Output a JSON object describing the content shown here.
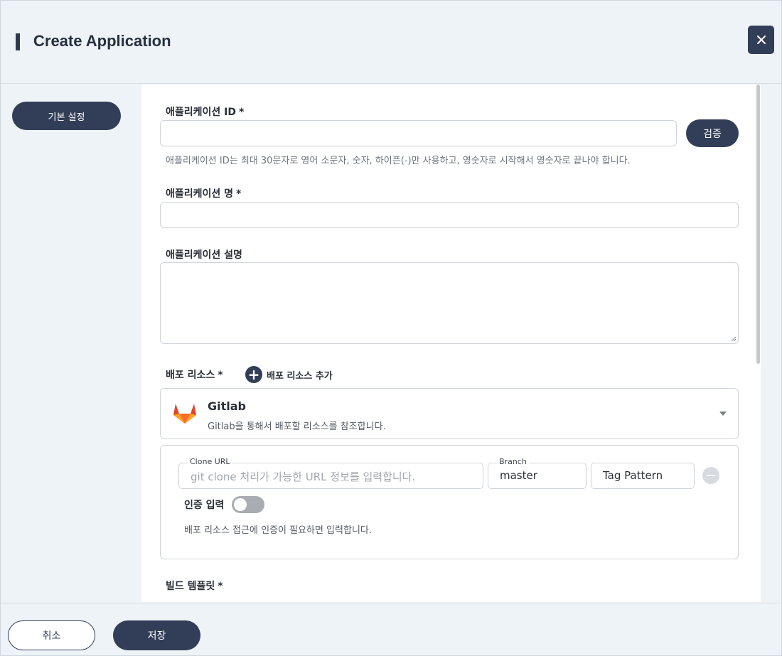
{
  "header": {
    "title": "Create Application",
    "close_icon": "close-icon"
  },
  "sidebar": {
    "basic_settings_label": "기본 설정"
  },
  "form": {
    "app_id": {
      "label": "애플리케이션 ID",
      "required_mark": "*",
      "value": "",
      "verify_label": "검증",
      "hint": "애플리케이션 ID는 최대 30문자로 영어 소문자, 숫자, 하이픈(-)만 사용하고, 영숫자로 시작해서 영숫자로 끝나야 합니다."
    },
    "app_name": {
      "label": "애플리케이션 명",
      "required_mark": "*",
      "value": ""
    },
    "app_description": {
      "label": "애플리케이션 설명",
      "value": ""
    },
    "deploy_resource": {
      "label": "배포 리소스",
      "required_mark": "*",
      "add_label": "배포 리소스 추가",
      "source": {
        "title": "Gitlab",
        "description": "Gitlab을 통해서 배포할 리소스를 참조합니다.",
        "icon": "gitlab-icon"
      },
      "clone_url": {
        "legend": "Clone URL",
        "placeholder": "git clone 처리가 가능한 URL 정보를 입력합니다.",
        "value": ""
      },
      "branch": {
        "legend": "Branch",
        "value": "master"
      },
      "tag_pattern": {
        "placeholder": "Tag Pattern"
      },
      "auth": {
        "label": "인증 입력",
        "enabled": false,
        "hint": "배포 리소스 접근에 인증이 필요하면 입력합니다."
      }
    },
    "build_template": {
      "label": "빌드 템플릿",
      "required_mark": "*"
    }
  },
  "footer": {
    "cancel_label": "취소",
    "save_label": "저장"
  },
  "colors": {
    "primary": "#323e57",
    "background": "#eef3f7",
    "gitlab_orange": "#e24329"
  }
}
